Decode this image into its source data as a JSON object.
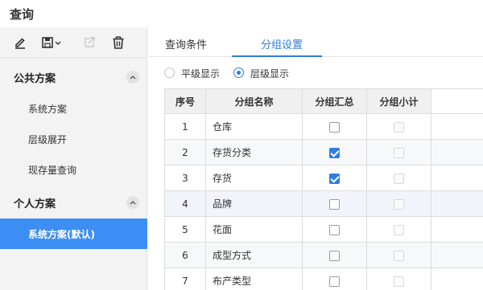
{
  "window": {
    "title": "查询"
  },
  "sidebar": {
    "toolbar": {
      "edit_icon": "pencil-icon",
      "save_icon": "floppy-dropdown-icon",
      "export_icon": "external-link-icon",
      "delete_icon": "trash-icon"
    },
    "groups": [
      {
        "label": "公共方案",
        "items": [
          "系统方案",
          "层级展开",
          "现存量查询"
        ]
      },
      {
        "label": "个人方案",
        "items": [
          "系统方案(默认)"
        ]
      }
    ]
  },
  "main": {
    "tabs": [
      {
        "label": "查询条件",
        "active": false
      },
      {
        "label": "分组设置",
        "active": true
      }
    ],
    "display_mode": {
      "options": [
        "平级显示",
        "层级显示"
      ],
      "selected": "层级显示"
    },
    "grid": {
      "columns": [
        "序号",
        "分组名称",
        "分组汇总",
        "分组小计"
      ],
      "rows": [
        {
          "no": "1",
          "name": "仓库",
          "summary": false,
          "subtotal": false
        },
        {
          "no": "2",
          "name": "存货分类",
          "summary": true,
          "subtotal": false
        },
        {
          "no": "3",
          "name": "存货",
          "summary": true,
          "subtotal": false
        },
        {
          "no": "4",
          "name": "品牌",
          "summary": false,
          "subtotal": false
        },
        {
          "no": "5",
          "name": "花面",
          "summary": false,
          "subtotal": false
        },
        {
          "no": "6",
          "name": "成型方式",
          "summary": false,
          "subtotal": false
        },
        {
          "no": "7",
          "name": "布产类型",
          "summary": false,
          "subtotal": false
        }
      ]
    }
  },
  "colors": {
    "accent": "#2f7de1",
    "selected_item_bg": "#3d8ef4",
    "sidebar_bg": "#f3f3f3"
  }
}
